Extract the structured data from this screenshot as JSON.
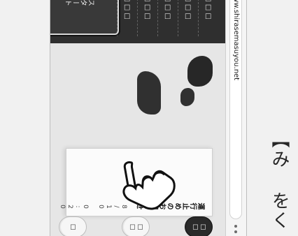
{
  "browser": {
    "url": "www.shirasemasuyou.net",
    "nav_icon": "refresh-icon"
  },
  "sidebar": {
    "rows": [
      {
        "label": "■ □ □ □ □"
      },
      {
        "label": "■ □ □ □ □"
      },
      {
        "label": "■ □ □ □ □"
      },
      {
        "label": "■ □ □ □ □"
      },
      {
        "label": "■ □ □ □ □"
      }
    ],
    "highlight_label": "スタート"
  },
  "notice": {
    "title": "運行止めのお知らせ",
    "date": "8/10 0:20"
  },
  "actions": {
    "btn1": "□□",
    "btn2": "□□",
    "btn3": "□"
  },
  "caption": {
    "text": "【み\nをく"
  }
}
